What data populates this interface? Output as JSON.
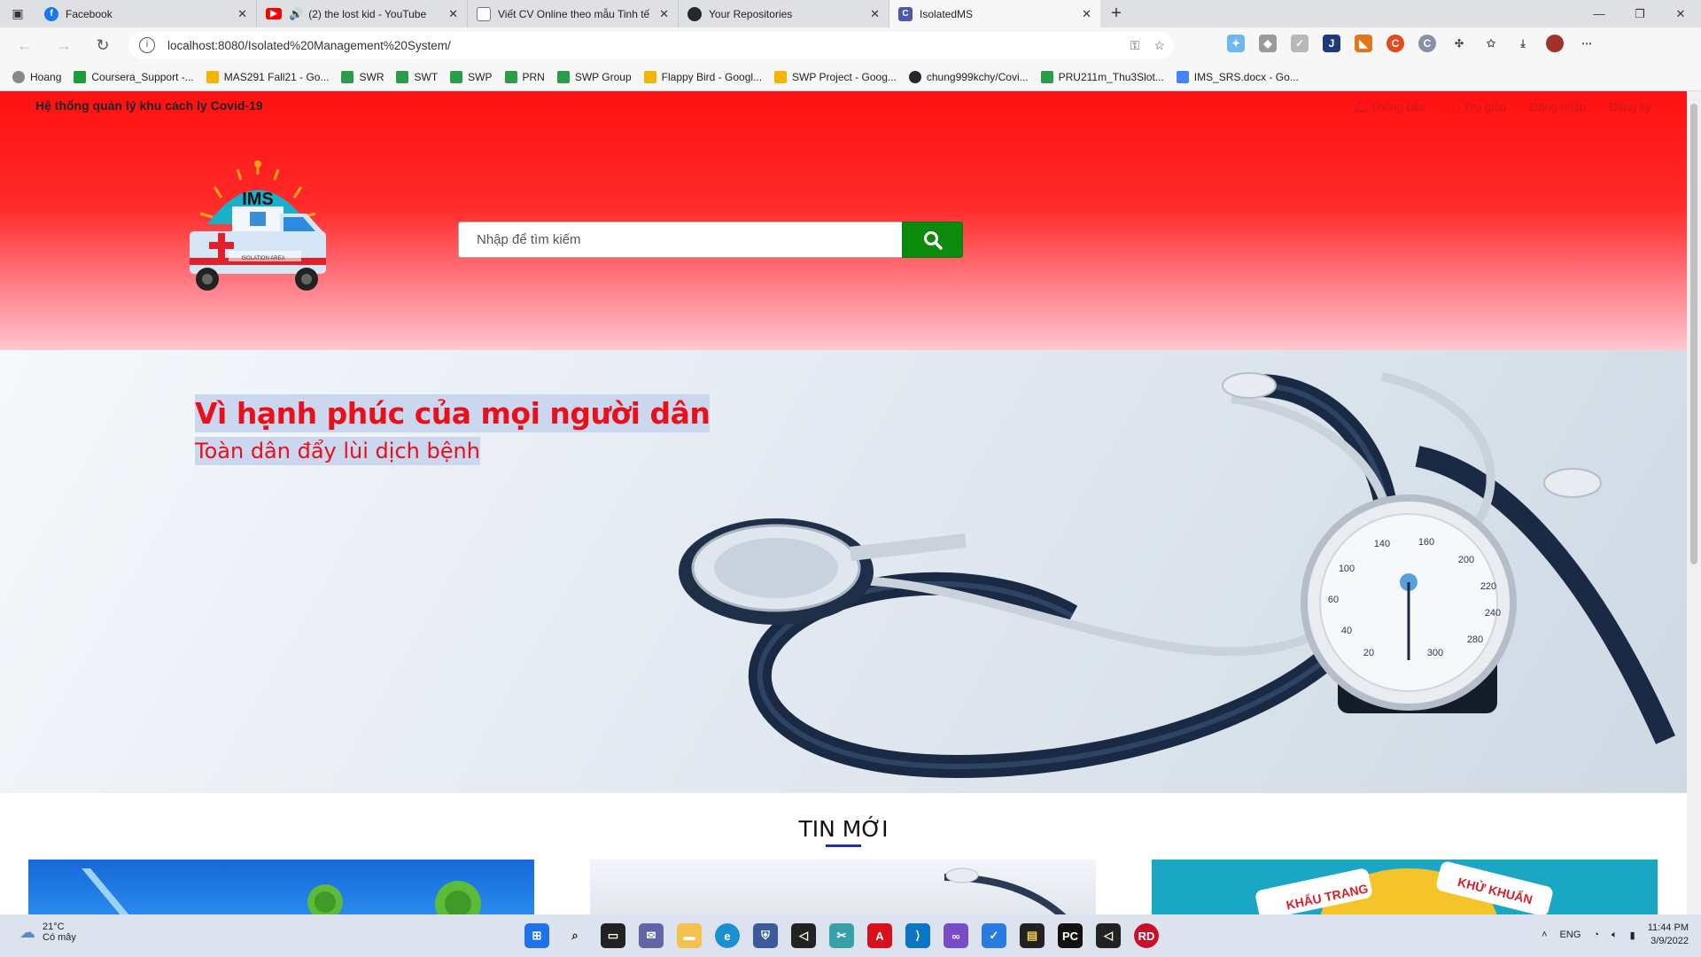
{
  "browser": {
    "tabs": [
      {
        "label": "Facebook",
        "icon": "facebook-icon",
        "color": "#1877f2",
        "active": false
      },
      {
        "label": "(2) the lost kid - YouTube",
        "icon": "youtube-icon",
        "color": "#ff0000",
        "active": false
      },
      {
        "label": "Viết CV Online theo mẫu Tinh tế",
        "icon": "document-icon",
        "color": "#777777",
        "active": false
      },
      {
        "label": "Your Repositories",
        "icon": "github-icon",
        "color": "#24292e",
        "active": false
      },
      {
        "label": "IsolatedMS",
        "icon": "page-icon",
        "color": "#4b5aa8",
        "active": true
      }
    ],
    "url": "localhost:8080/Isolated%20Management%20System/",
    "bookmarks": [
      {
        "label": "Hoang",
        "color": "#555555"
      },
      {
        "label": "Coursera_Support -...",
        "color": "#1a9e3a"
      },
      {
        "label": "MAS291 Fall21 - Go...",
        "color": "#f4b400"
      },
      {
        "label": "SWR",
        "color": "#ff9800"
      },
      {
        "label": "SWT",
        "color": "#ff9800"
      },
      {
        "label": "SWP",
        "color": "#ff9800"
      },
      {
        "label": "PRN",
        "color": "#ff9800"
      },
      {
        "label": "SWP Group",
        "color": "#ff9800"
      },
      {
        "label": "Flappy Bird - Googl...",
        "color": "#f4b400"
      },
      {
        "label": "SWP Project - Goog...",
        "color": "#f4b400"
      },
      {
        "label": "chung999kchy/Covi...",
        "color": "#24292e"
      },
      {
        "label": "PRU211m_Thu3Slot...",
        "color": "#ff9800"
      },
      {
        "label": "IMS_SRS.docx - Go...",
        "color": "#4285f4"
      }
    ]
  },
  "site": {
    "brand_text": "Hệ thống quản lý khu cách ly Covid-19",
    "links": {
      "notifications": "Thông báo",
      "help": "Trợ giúp",
      "login": "Đăng nhập",
      "register": "Đăng ký"
    },
    "logo_text": "IMS",
    "logo_banner": "ISOLATION AREA",
    "search": {
      "placeholder": "Nhập để tìm kiếm"
    },
    "hero": {
      "title": "Vì hạnh phúc của mọi người dân",
      "subtitle": "Toàn dân đẩy lùi dịch bệnh"
    },
    "news": {
      "title": "TIN MỚI",
      "card_texts": [
        "KHẨU TRANG",
        "KHỬ KHUẨN"
      ]
    },
    "colors": {
      "header": "#ff1a1a",
      "search_button": "#0b8a0b",
      "hero_text": "#e8101a"
    }
  },
  "taskbar": {
    "weather_temp": "21°C",
    "weather_desc": "Có mây",
    "lang": "ENG",
    "time": "11:44 PM",
    "date": "3/9/2022"
  }
}
